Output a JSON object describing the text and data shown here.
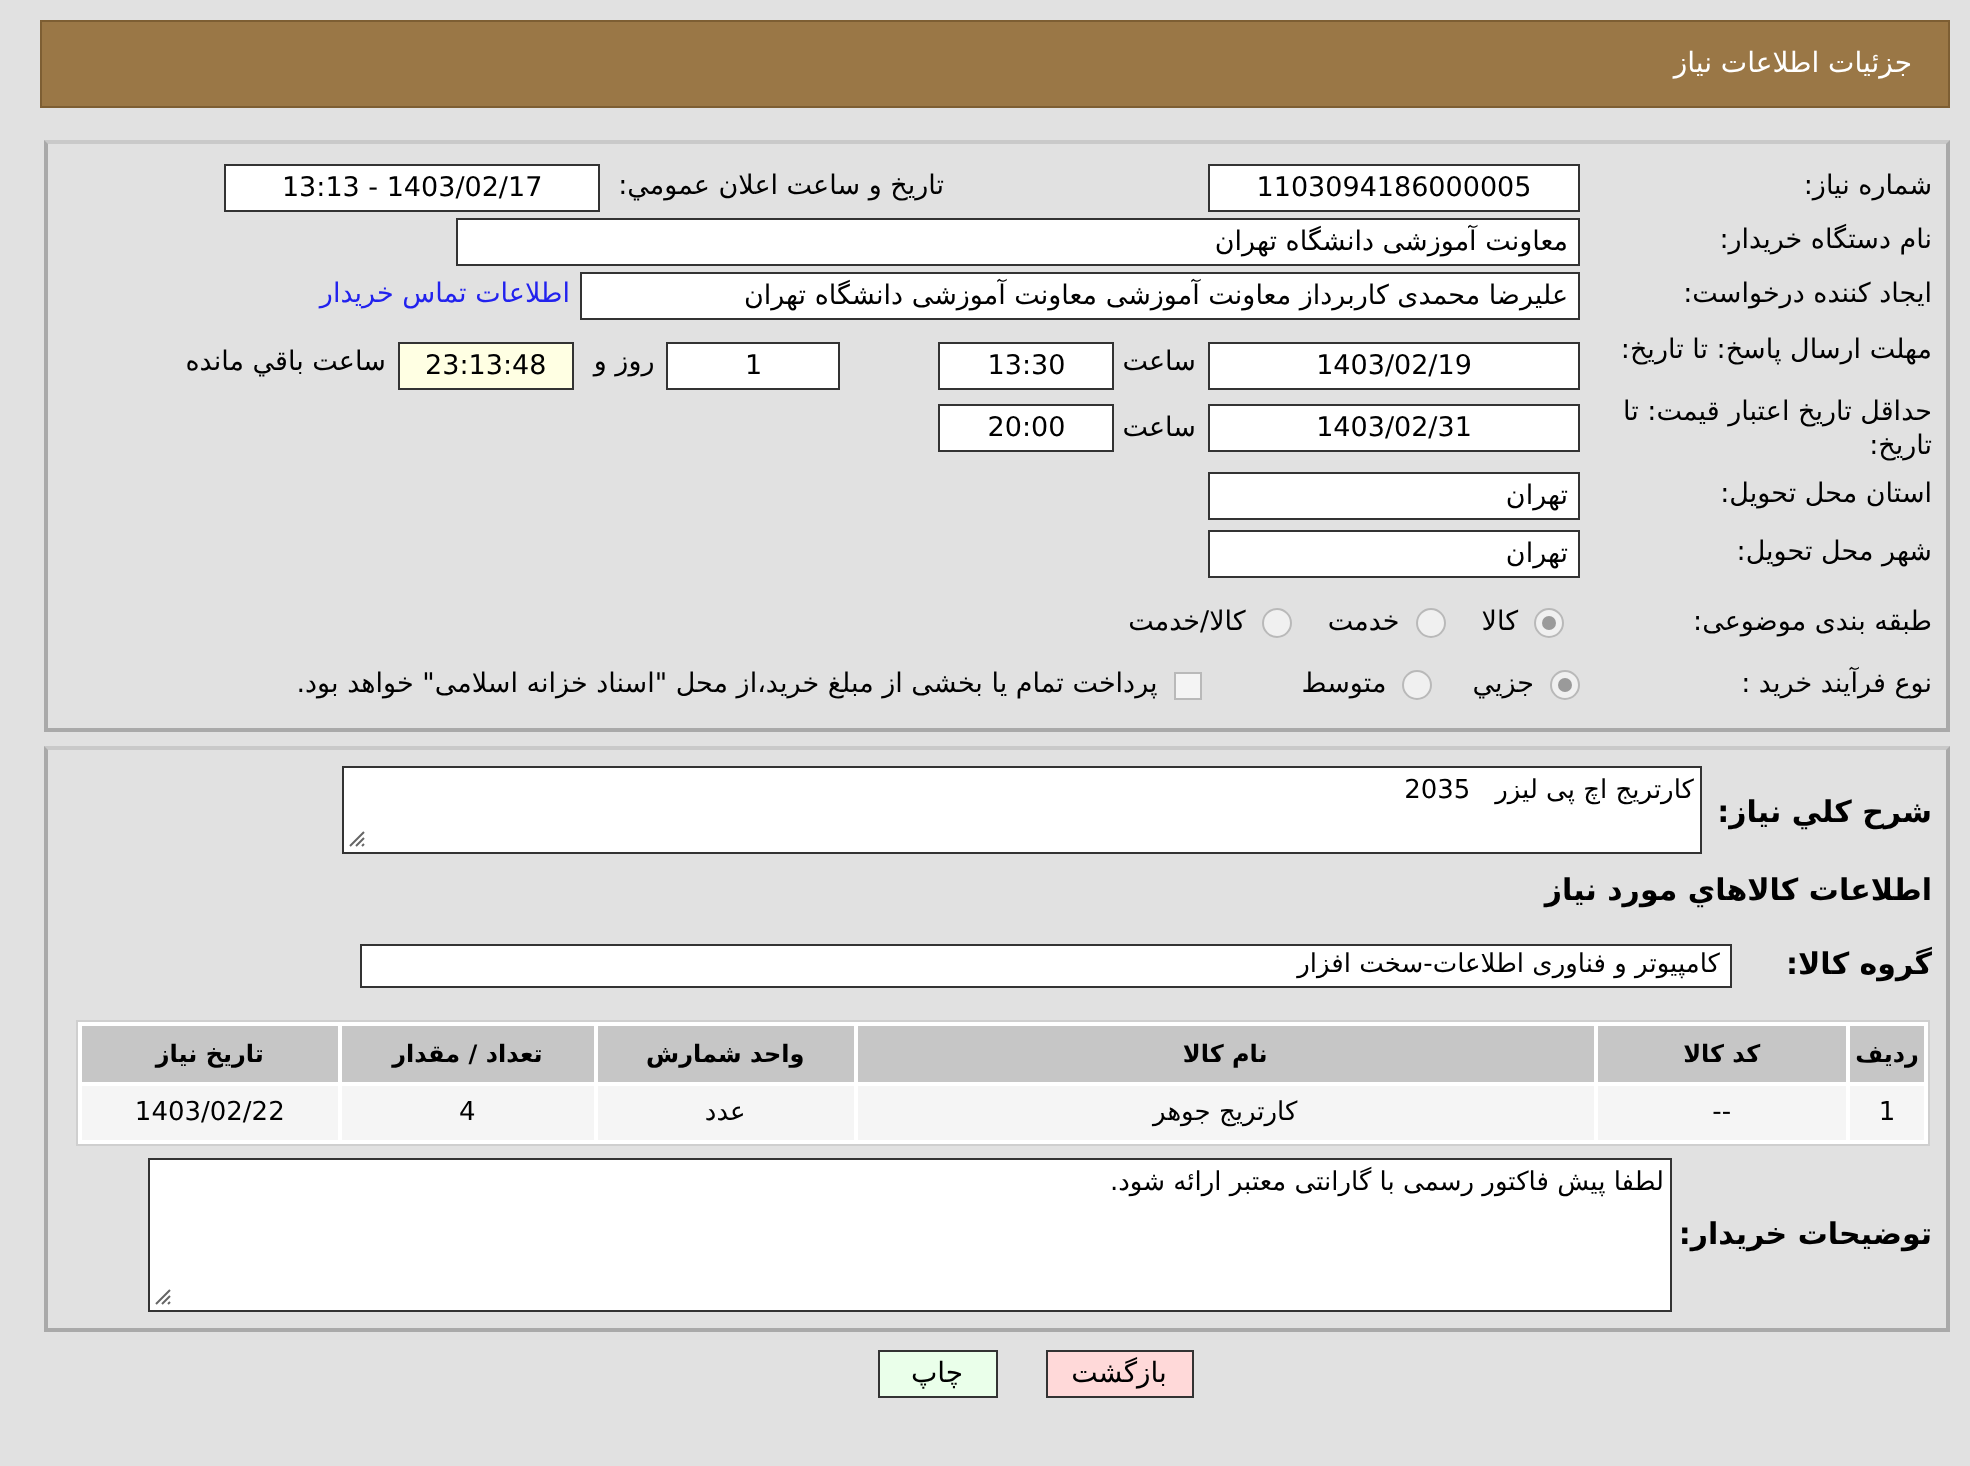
{
  "header": {
    "title": "جزئیات اطلاعات نیاز"
  },
  "need_number": {
    "label": "شماره نیاز:",
    "value": "1103094186000005"
  },
  "announce": {
    "label": "تاريخ و ساعت اعلان عمومي:",
    "value": "1403/02/17 - 13:13"
  },
  "buyer_org": {
    "label": "نام دستگاه خریدار:",
    "value": "معاونت آموزشی دانشگاه تهران"
  },
  "requester": {
    "label": "ایجاد کننده درخواست:",
    "value": "علیرضا محمدی کاربرداز معاونت آموزشی معاونت آموزشی دانشگاه تهران",
    "link": "اطلاعات تماس خریدار"
  },
  "reply_deadline": {
    "label": "مهلت ارسال پاسخ: تا تاریخ:",
    "date": "1403/02/19",
    "time_label": "ساعت",
    "time": "13:30",
    "days": "1",
    "days_label": "روز و",
    "remaining": "23:13:48",
    "remaining_label": "ساعت باقي مانده"
  },
  "price_validity": {
    "label": "حداقل تاریخ اعتبار قیمت: تا تاریخ:",
    "date": "1403/02/31",
    "time_label": "ساعت",
    "time": "20:00"
  },
  "province": {
    "label": "استان محل تحویل:",
    "value": "تهران"
  },
  "city": {
    "label": "شهر محل تحویل:",
    "value": "تهران"
  },
  "category": {
    "label": "طبقه بندی موضوعی:",
    "options": [
      {
        "label": "کالا",
        "selected": true
      },
      {
        "label": "خدمت",
        "selected": false
      },
      {
        "label": "کالا/خدمت",
        "selected": false
      }
    ]
  },
  "process": {
    "label": "نوع فرآیند خرید :",
    "options": [
      {
        "label": "جزيي",
        "selected": true
      },
      {
        "label": "متوسط",
        "selected": false
      }
    ],
    "treasury": {
      "checked": false,
      "text": "پرداخت تمام یا بخشی از مبلغ خرید،از محل \"اسناد خزانه اسلامی\" خواهد بود."
    }
  },
  "description": {
    "label": "شرح كلي نياز:",
    "value": "کارتریج اچ پی لیزر   2035"
  },
  "goods_heading": "اطلاعات كالاهاي مورد نياز",
  "goods_group": {
    "label": "گروه کالا:",
    "value": "کامپیوتر و فناوری اطلاعات-سخت افزار"
  },
  "table": {
    "columns": [
      "ردیف",
      "کد کالا",
      "نام کالا",
      "واحد شمارش",
      "تعداد / مقدار",
      "تاریخ نیاز"
    ],
    "rows": [
      [
        "1",
        "--",
        "کارتریج جوهر",
        "عدد",
        "4",
        "1403/02/22"
      ]
    ]
  },
  "buyer_notes": {
    "label": "توضیحات خریدار:",
    "value": "لطفا پیش فاکتور رسمی با گارانتی معتبر ارائه شود."
  },
  "buttons": [
    {
      "label": "بازگشت",
      "kind": "back"
    },
    {
      "label": "چاپ",
      "kind": "print"
    }
  ]
}
